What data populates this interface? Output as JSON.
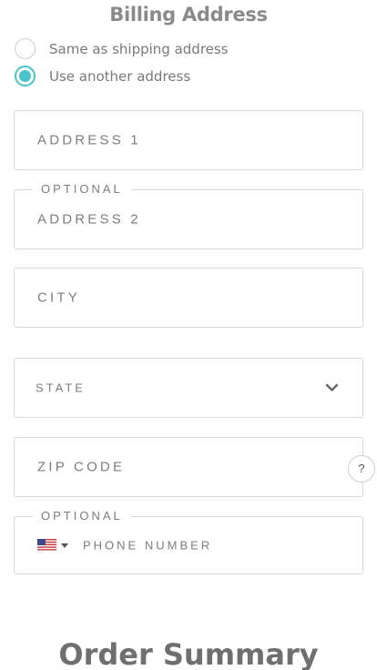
{
  "billing": {
    "title": "Billing Address",
    "options": [
      {
        "label": "Same as shipping address",
        "selected": false
      },
      {
        "label": "Use another address",
        "selected": true
      }
    ],
    "accent_color": "#47c3c9"
  },
  "fields": {
    "address1": {
      "placeholder": "ADDRESS 1"
    },
    "address2": {
      "placeholder": "ADDRESS 2",
      "legend": "OPTIONAL"
    },
    "city": {
      "placeholder": "CITY"
    },
    "state": {
      "placeholder": "STATE",
      "icon": "chevron-down-icon"
    },
    "zip": {
      "placeholder": "ZIP CODE",
      "help": "?"
    },
    "phone": {
      "placeholder": "PHONE NUMBER",
      "legend": "OPTIONAL",
      "country_flag": "us-flag-icon"
    }
  },
  "order_summary": {
    "title": "Order Summary"
  }
}
